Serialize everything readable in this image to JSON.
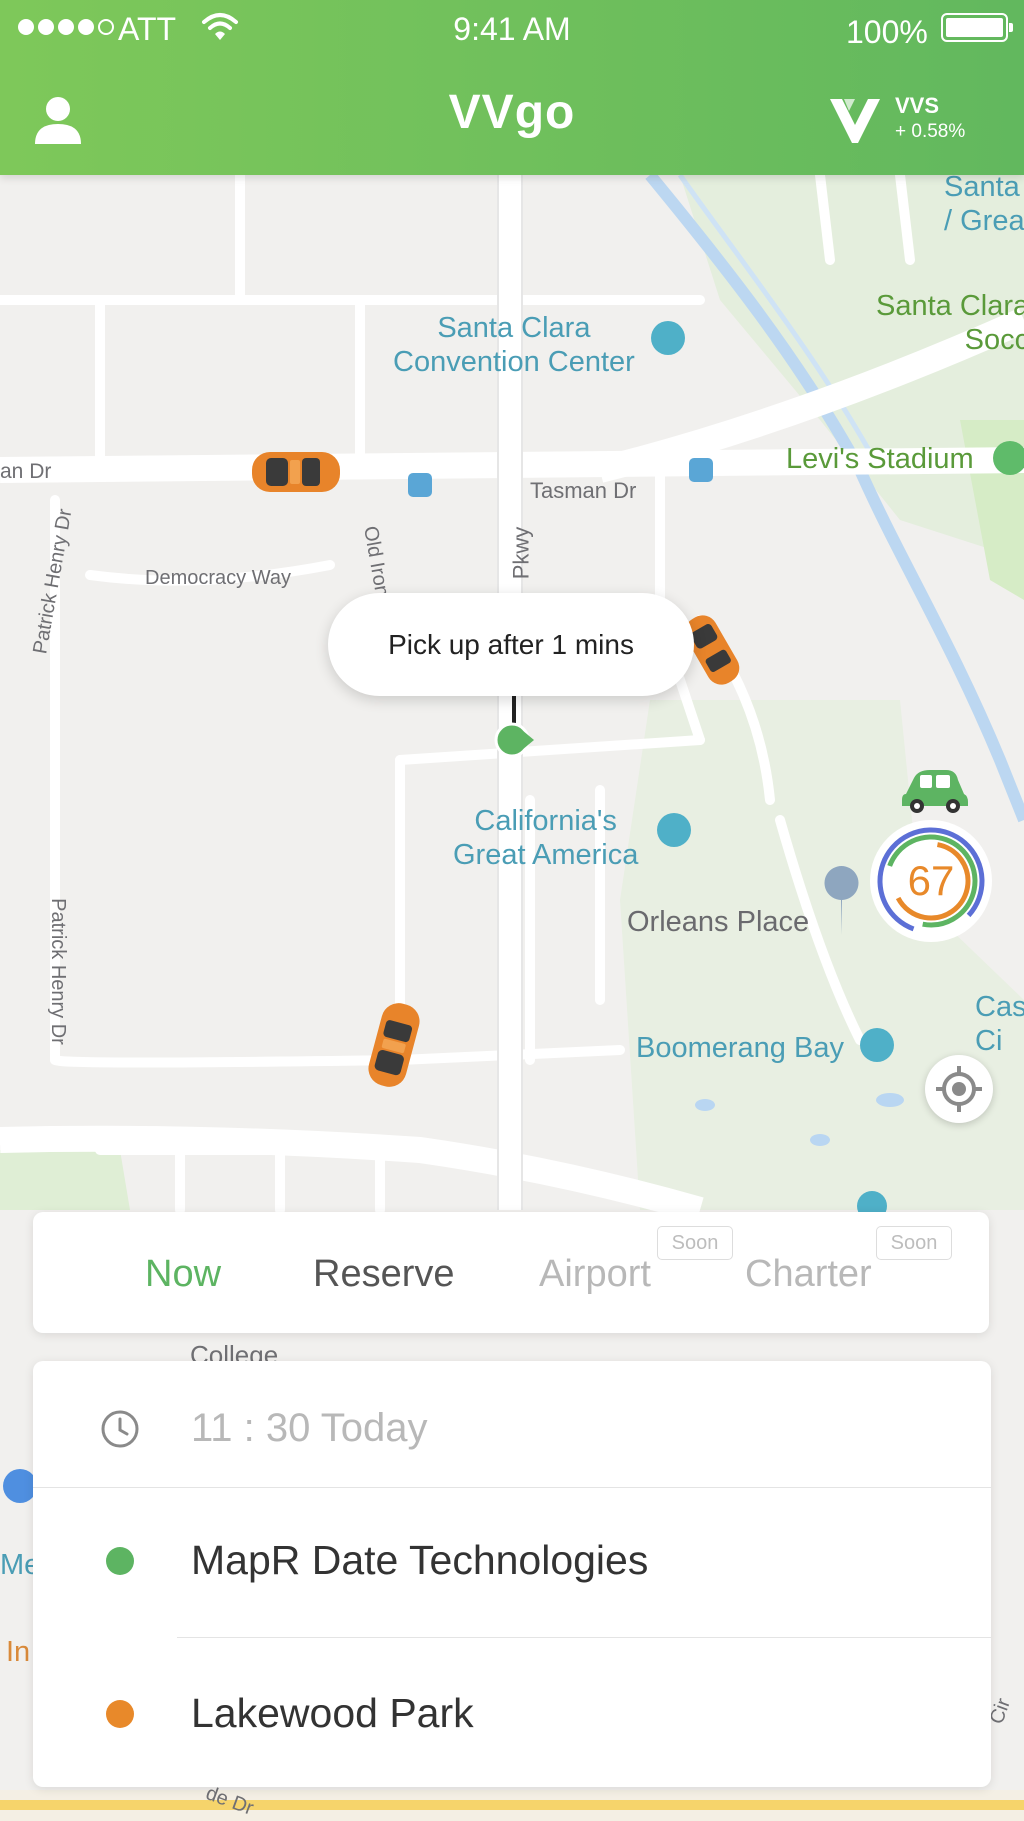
{
  "status_bar": {
    "carrier": "ATT",
    "time": "9:41 AM",
    "battery": "100%"
  },
  "nav": {
    "title": "VVgo",
    "ticker": "VVS",
    "ticker_change": "+ 0.58%"
  },
  "map": {
    "pois": {
      "santa_clara_great_america_top": "Santa\n/ Grea",
      "convention_center": "Santa Clara\nConvention Center",
      "santa_clara_soccer": "Santa Clara\nSocc",
      "levis_stadium": "Levi's Stadium",
      "californias_great_america": "California's\nGreat America",
      "orleans_place": "Orleans Place",
      "boomerang_bay": "Boomerang Bay",
      "cas_edge": "Cas\nCi",
      "college": "College",
      "me_edge": "Me",
      "in_edge": "In"
    },
    "streets": {
      "tasman_left": "an Dr",
      "tasman_right": "Tasman Dr",
      "democracy_way": "Democracy Way",
      "patrick_henry_top": "Patrick Henry Dr",
      "patrick_henry_bottom": "Patrick Henry Dr",
      "old_iron": "Old Iron",
      "pkwy": "Pkwy",
      "cir": "Cir",
      "de_dr": "de Dr"
    }
  },
  "pickup_bubble": "Pick up after 1 mins",
  "score": "67",
  "tabs": {
    "now": "Now",
    "reserve": "Reserve",
    "airport": "Airport",
    "charter": "Charter",
    "soon": "Soon"
  },
  "trip": {
    "time": "11 : 30 Today",
    "origin": "MapR Date Technologies",
    "destination": "Lakewood Park"
  },
  "colors": {
    "brand_green": "#62b85e",
    "origin_dot": "#5db462",
    "destination_dot": "#e8892a",
    "score_orange": "#e8892a"
  }
}
